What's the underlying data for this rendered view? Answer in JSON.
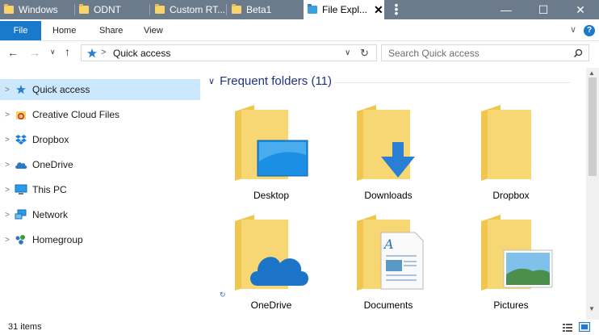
{
  "tabs": [
    {
      "label": "Windows"
    },
    {
      "label": "ODNT"
    },
    {
      "label": "Custom RT..."
    },
    {
      "label": "Beta1"
    },
    {
      "label": "File Expl..."
    }
  ],
  "window": {
    "minimize": "—",
    "maximize": "☐",
    "close": "✕",
    "tab_close": "✕"
  },
  "ribbon": {
    "file": "File",
    "home": "Home",
    "share": "Share",
    "view": "View",
    "help": "?"
  },
  "address": {
    "separator": ">",
    "location": "Quick access"
  },
  "search": {
    "placeholder": "Search Quick access"
  },
  "nav": [
    {
      "label": "Quick access",
      "icon": "star-icon"
    },
    {
      "label": "Creative Cloud Files",
      "icon": "creative-cloud-icon"
    },
    {
      "label": "Dropbox",
      "icon": "dropbox-icon"
    },
    {
      "label": "OneDrive",
      "icon": "onedrive-icon"
    },
    {
      "label": "This PC",
      "icon": "monitor-icon"
    },
    {
      "label": "Network",
      "icon": "network-icon"
    },
    {
      "label": "Homegroup",
      "icon": "homegroup-icon"
    }
  ],
  "group": {
    "title": "Frequent folders (11)"
  },
  "folders": [
    {
      "label": "Desktop",
      "overlay": "desktop-icon"
    },
    {
      "label": "Downloads",
      "overlay": "download-arrow-icon"
    },
    {
      "label": "Dropbox",
      "overlay": "none"
    },
    {
      "label": "OneDrive",
      "overlay": "onedrive-cloud-icon"
    },
    {
      "label": "Documents",
      "overlay": "document-icon"
    },
    {
      "label": "Pictures",
      "overlay": "picture-icon"
    }
  ],
  "status": {
    "items": "31 items"
  },
  "colors": {
    "titlebar": "#6b7b8c",
    "accent": "#1979ca",
    "selection": "#cce8ff",
    "folder": "#f6d36b",
    "group_title": "#1e3287"
  }
}
